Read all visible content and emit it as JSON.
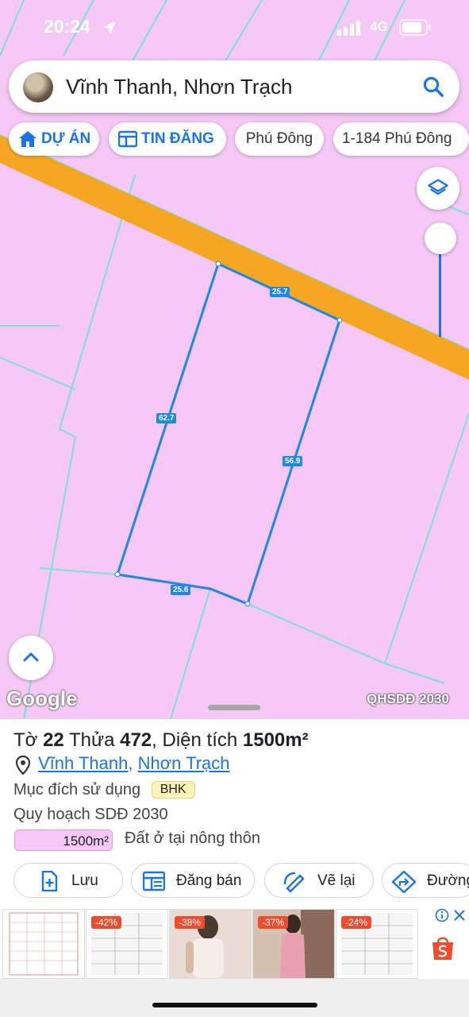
{
  "status_bar": {
    "time": "20:24",
    "network": "4G"
  },
  "search": {
    "query": "Vĩnh Thanh, Nhơn Trạch"
  },
  "chips": [
    {
      "label": "DỰ ÁN",
      "icon": "home-icon"
    },
    {
      "label": "TIN ĐĂNG",
      "icon": "listing-icon"
    },
    {
      "label": "Phú Đông"
    },
    {
      "label": "1-184 Phú Đông"
    }
  ],
  "map": {
    "dimensions": {
      "top": "25.7",
      "left": "62.7",
      "right": "56.9",
      "bottom": "25.6"
    },
    "google_logo": "Google",
    "layer_label": "QHSDĐ 2030",
    "colors": {
      "land": "#f5c8f5",
      "road": "#f5a623",
      "parcel_line": "#1e88e5",
      "boundary": "#7de0d8"
    }
  },
  "parcel": {
    "title_prefix": "Tờ",
    "sheet": "22",
    "plot_label": "Thửa",
    "plot": "472",
    "area_label": "Diện tích",
    "area": "1500m²",
    "ward": "Vĩnh Thanh",
    "separator": ",",
    "district": "Nhơn Trạch",
    "purpose_label": "Mục đích sử dụng",
    "purpose_code": "BHK",
    "plan_label": "Quy hoạch SDĐ 2030",
    "plan_area": "1500m²",
    "plan_use": "Đất ở tại nông thôn"
  },
  "actions": [
    {
      "label": "Lưu",
      "icon": "bookmark-plus-icon"
    },
    {
      "label": "Đăng bán",
      "icon": "post-listing-icon"
    },
    {
      "label": "Vẽ lại",
      "icon": "redraw-icon"
    },
    {
      "label": "Đường",
      "icon": "directions-icon"
    }
  ],
  "ads": {
    "discounts": [
      "-42%",
      "-38%",
      "-37%",
      "-24%"
    ]
  }
}
